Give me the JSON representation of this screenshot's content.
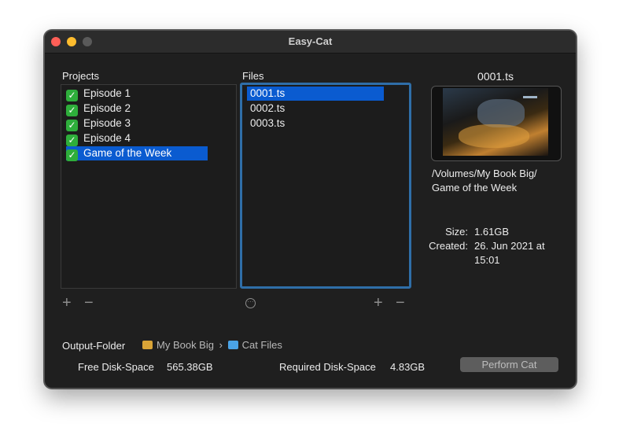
{
  "window": {
    "title": "Easy-Cat"
  },
  "projects": {
    "label": "Projects",
    "items": [
      {
        "name": "Episode 1",
        "checked": true
      },
      {
        "name": "Episode 2",
        "checked": true
      },
      {
        "name": "Episode 3",
        "checked": true
      },
      {
        "name": "Episode 4",
        "checked": true
      },
      {
        "name": "Game of the Week",
        "checked": true,
        "selected": true
      }
    ],
    "add_label": "+",
    "remove_label": "−"
  },
  "files": {
    "label": "Files",
    "items": [
      {
        "name": "0001.ts",
        "selected": true
      },
      {
        "name": "0002.ts"
      },
      {
        "name": "0003.ts"
      }
    ],
    "more_label": "···",
    "add_label": "+",
    "remove_label": "−"
  },
  "preview": {
    "filename": "0001.ts",
    "path_line1": "/Volumes/My Book Big/",
    "path_line2": "Game of the Week",
    "size_label": "Size:",
    "size_value": "1.61GB",
    "created_label": "Created:",
    "created_line1": "26. Jun 2021 at",
    "created_line2": "15:01"
  },
  "output": {
    "label": "Output-Folder",
    "crumb1": "My Book Big",
    "separator": "›",
    "crumb2": "Cat Files",
    "free_label": "Free Disk-Space",
    "free_value": "565.38GB",
    "required_label": "Required Disk-Space",
    "required_value": "4.83GB",
    "perform_label": "Perform Cat"
  },
  "colors": {
    "accent": "#0a5bd0",
    "check": "#2eae3b",
    "focus_ring": "#2f6ea8"
  },
  "icons": {
    "check": "✓",
    "drive": "drive-icon",
    "folder": "folder-icon"
  }
}
